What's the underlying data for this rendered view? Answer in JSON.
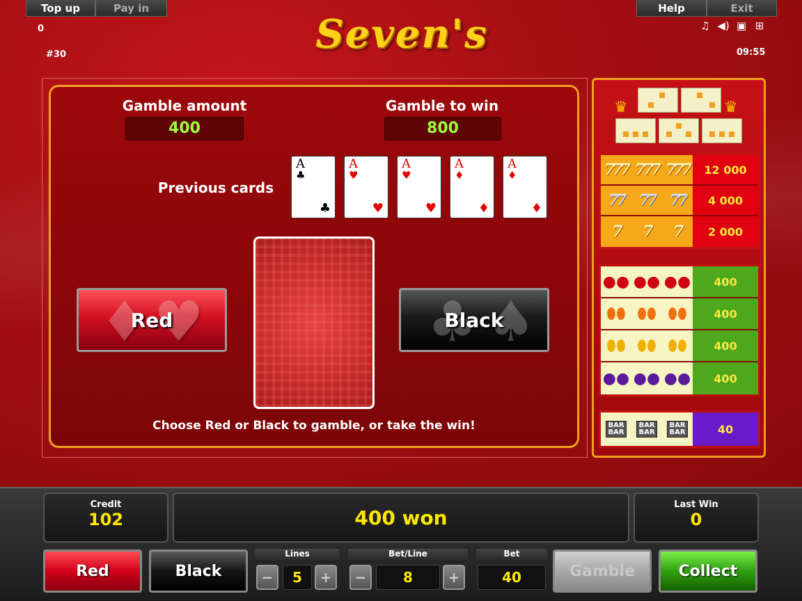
{
  "topbar": {
    "topup": "Top up",
    "payin": "Pay in",
    "help": "Help",
    "exit": "Exit"
  },
  "status": {
    "balance": "0",
    "game_number": "#30",
    "clock": "09:55"
  },
  "logo_text": "Seven's",
  "gamble": {
    "amount_label": "Gamble amount",
    "amount_value": "400",
    "towin_label": "Gamble to win",
    "towin_value": "800",
    "previous_label": "Previous cards",
    "previous_cards": [
      {
        "rank": "A",
        "suit": "♣",
        "color": "black"
      },
      {
        "rank": "A",
        "suit": "♥",
        "color": "red"
      },
      {
        "rank": "A",
        "suit": "♥",
        "color": "red"
      },
      {
        "rank": "A",
        "suit": "♦",
        "color": "red"
      },
      {
        "rank": "A",
        "suit": "♦",
        "color": "red"
      }
    ],
    "red_label": "Red",
    "black_label": "Black",
    "hint": "Choose Red or Black to gamble, or take the win!"
  },
  "paytable": {
    "sevens": [
      {
        "symbol": "777",
        "value": "12 000"
      },
      {
        "symbol": "77",
        "value": "4 000"
      },
      {
        "symbol": "7",
        "value": "2 000"
      }
    ],
    "fruits": [
      {
        "symbol": "🍒",
        "value": "400"
      },
      {
        "symbol": "◉",
        "value": "400"
      },
      {
        "symbol": "◉",
        "value": "400"
      },
      {
        "symbol": "●",
        "value": "400"
      }
    ],
    "bar_label": "BAR",
    "bar_value": "40"
  },
  "console": {
    "credit_label": "Credit",
    "credit_value": "102",
    "message": "400 won",
    "lastwin_label": "Last Win",
    "lastwin_value": "0",
    "red_label": "Red",
    "black_label": "Black",
    "lines_label": "Lines",
    "lines_value": "5",
    "betline_label": "Bet/Line",
    "betline_value": "8",
    "bet_label": "Bet",
    "bet_value": "40",
    "minus": "−",
    "plus": "+",
    "gamble_label": "Gamble",
    "collect_label": "Collect"
  }
}
